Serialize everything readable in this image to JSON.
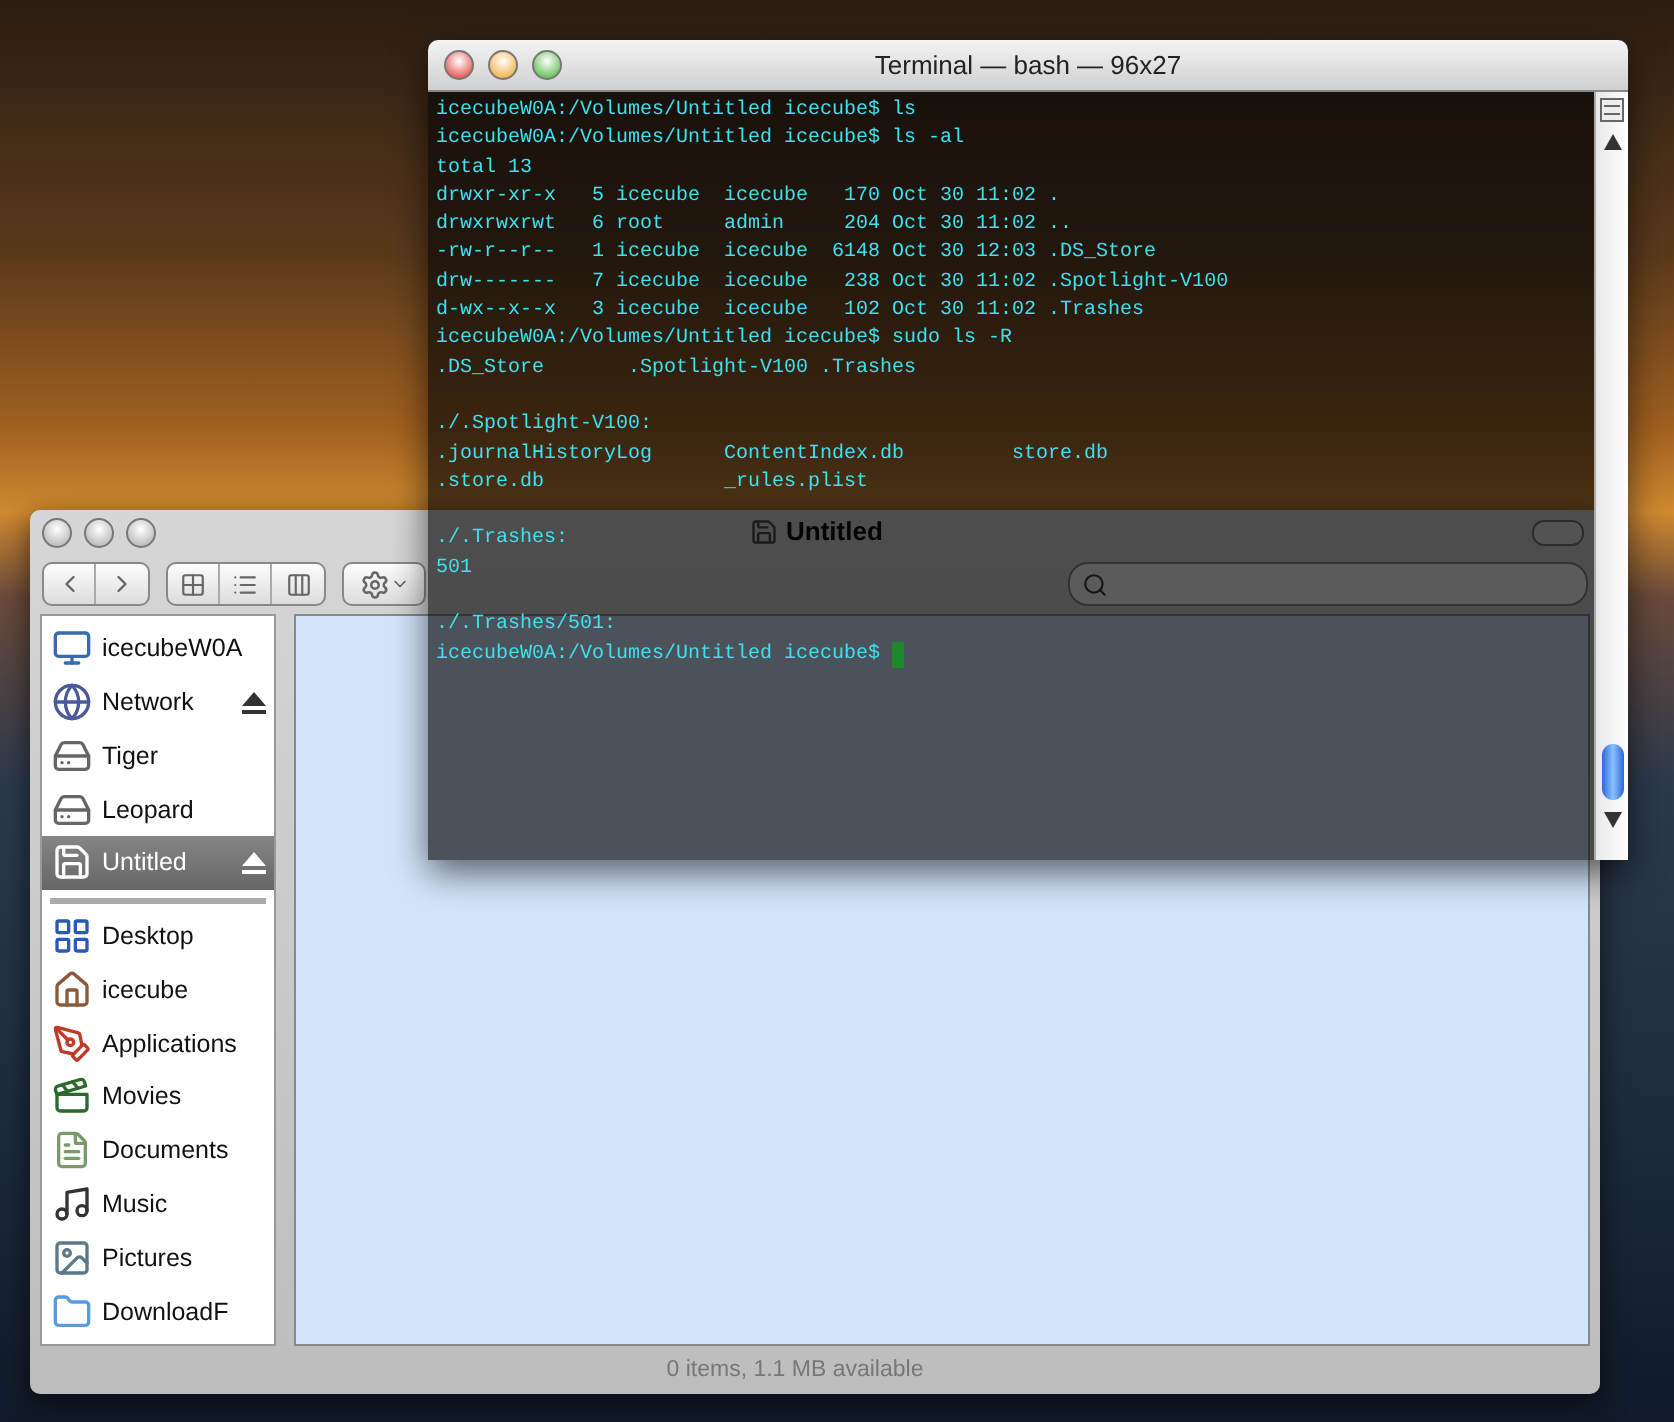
{
  "finder": {
    "title": "Untitled",
    "sidebar": {
      "devices": [
        {
          "label": "icecubeW0A",
          "kind": "computer",
          "selected": false,
          "ejectable": false
        },
        {
          "label": "Network",
          "kind": "network",
          "selected": false,
          "ejectable": true
        },
        {
          "label": "Tiger",
          "kind": "disk",
          "selected": false,
          "ejectable": false
        },
        {
          "label": "Leopard",
          "kind": "disk",
          "selected": false,
          "ejectable": false
        },
        {
          "label": "Untitled",
          "kind": "floppy",
          "selected": true,
          "ejectable": true
        }
      ],
      "places": [
        {
          "label": "Desktop",
          "kind": "desktop",
          "selected": false
        },
        {
          "label": "icecube",
          "kind": "home",
          "selected": false
        },
        {
          "label": "Applications",
          "kind": "applications",
          "selected": false
        },
        {
          "label": "Movies",
          "kind": "movies",
          "selected": false
        },
        {
          "label": "Documents",
          "kind": "documents",
          "selected": false
        },
        {
          "label": "Music",
          "kind": "music",
          "selected": false
        },
        {
          "label": "Pictures",
          "kind": "pictures",
          "selected": false
        },
        {
          "label": "DownloadF",
          "kind": "folder",
          "selected": false
        }
      ]
    },
    "status": "0 items, 1.1 MB available"
  },
  "terminal": {
    "title": "Terminal — bash — 96x27",
    "paragraphs": [
      [
        "icecubeW0A:/Volumes/Untitled icecube$ ls",
        "icecubeW0A:/Volumes/Untitled icecube$ ls -al",
        "total 13",
        "drwxr-xr-x   5 icecube  icecube   170 Oct 30 11:02 .",
        "drwxrwxrwt   6 root     admin     204 Oct 30 11:02 ..",
        "-rw-r--r--   1 icecube  icecube  6148 Oct 30 12:03 .DS_Store",
        "drw-------   7 icecube  icecube   238 Oct 30 11:02 .Spotlight-V100",
        "d-wx--x--x   3 icecube  icecube   102 Oct 30 11:02 .Trashes",
        "icecubeW0A:/Volumes/Untitled icecube$ sudo ls -R",
        ".DS_Store       .Spotlight-V100 .Trashes"
      ],
      [
        "./.Spotlight-V100:",
        ".journalHistoryLog      ContentIndex.db         store.db",
        ".store.db               _rules.plist"
      ],
      [
        "./.Trashes:",
        "501"
      ],
      [
        "./.Trashes/501:",
        "icecubeW0A:/Volumes/Untitled icecube$ "
      ]
    ]
  }
}
